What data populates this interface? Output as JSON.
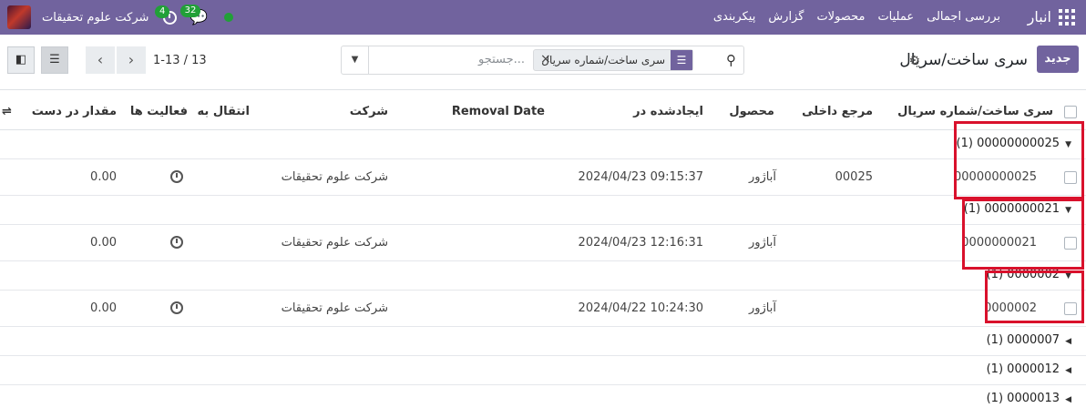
{
  "nav": {
    "app_name": "انبار",
    "menu": [
      "بررسی اجمالی",
      "عملیات",
      "محصولات",
      "گزارش",
      "پیکربندی"
    ],
    "company": "شرکت علوم تحقیقات",
    "chat_badge": "32",
    "activity_badge": "4"
  },
  "control": {
    "new_button": "جدید",
    "title": "سری ساخت/سریال",
    "search_placeholder": "جستجو...",
    "facet_label": "سری ساخت/شماره سریال",
    "pager": "1-13 / 13"
  },
  "columns": {
    "lot": "سری ساخت/شماره سریال",
    "ref": "مرجع داخلی",
    "product": "محصول",
    "created": "ایجادشده در",
    "removal": "Removal Date",
    "company": "شرکت",
    "transfer": "انتقال به",
    "activities": "فعالیت ها",
    "qty": "مقدار در دست"
  },
  "groups": [
    {
      "label": "00000000025 (1)",
      "expanded": true
    },
    {
      "label": "0000000021 (1)",
      "expanded": true
    },
    {
      "label": "0000002 (1)",
      "expanded": true
    },
    {
      "label": "0000007 (1)",
      "expanded": false
    },
    {
      "label": "0000012 (1)",
      "expanded": false
    },
    {
      "label": "0000013 (1)",
      "expanded": false
    }
  ],
  "records": [
    {
      "lot": "00000000025",
      "ref": "00025",
      "product": "آباژور",
      "created": "2024/04/23 09:15:37",
      "company": "شرکت علوم تحقیقات",
      "qty": "0.00"
    },
    {
      "lot": "0000000021",
      "ref": "",
      "product": "آباژور",
      "created": "2024/04/23 12:16:31",
      "company": "شرکت علوم تحقیقات",
      "qty": "0.00"
    },
    {
      "lot": "0000002",
      "ref": "",
      "product": "آباژور",
      "created": "2024/04/22 10:24:30",
      "company": "شرکت علوم تحقیقات",
      "qty": "0.00"
    }
  ],
  "colors": {
    "brand": "#71639e",
    "highlight": "#d9112c",
    "badge": "#21a038"
  }
}
